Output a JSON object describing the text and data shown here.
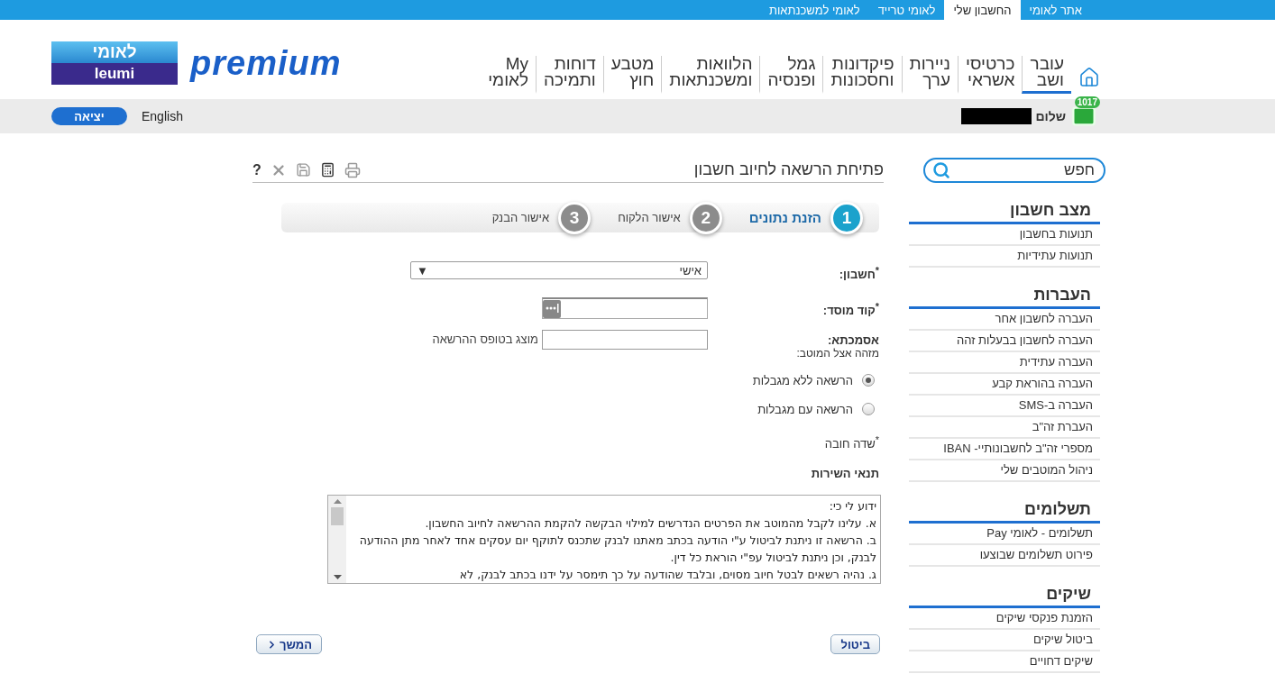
{
  "top_bar": {
    "tabs": [
      {
        "label": "אתר לאומי",
        "selected": false
      },
      {
        "label": "החשבון שלי",
        "selected": true
      },
      {
        "label": "לאומי טרייד",
        "selected": false
      },
      {
        "label": "לאומי למשכנתאות",
        "selected": false
      }
    ]
  },
  "logo": {
    "hebrew": "לאומי",
    "latin": "leumi",
    "tagline": "premium"
  },
  "main_nav": [
    {
      "label": "עובר ושב",
      "selected": true
    },
    {
      "label": "כרטיסי אשראי",
      "selected": false
    },
    {
      "label": "ניירות ערך",
      "selected": false
    },
    {
      "label": "פיקדונות וחסכונות",
      "selected": false
    },
    {
      "label": "גמל ופנסיה",
      "selected": false
    },
    {
      "label": "הלוואות ומשכנתאות",
      "selected": false
    },
    {
      "label": "מטבע חוץ",
      "selected": false
    },
    {
      "label": "דוחות ותמיכה",
      "selected": false
    },
    {
      "label": "My לאומי",
      "selected": false
    }
  ],
  "user_bar": {
    "messages_count": "1017",
    "greeting": "שלום",
    "language_link": "English",
    "logout_button": "יציאה"
  },
  "sidebar": {
    "search": {
      "placeholder": "חפש"
    },
    "sections": [
      {
        "title": "מצב חשבון",
        "items": [
          "תנועות בחשבון",
          "תנועות עתידיות"
        ]
      },
      {
        "title": "העברות",
        "items": [
          "העברה לחשבון אחר",
          "העברה לחשבון בבעלות זהה",
          "העברה עתידית",
          "העברה בהוראת קבע",
          "העברה ב-SMS",
          "העברת זה\"ב",
          "מספרי זה\"ב לחשבונותיי- IBAN",
          "ניהול המוטבים שלי"
        ]
      },
      {
        "title": "תשלומים",
        "items": [
          "תשלומים - לאומי Pay",
          "פירוט תשלומים שבוצעו"
        ]
      },
      {
        "title": "שיקים",
        "items": [
          "הזמנת פנקסי שיקים",
          "ביטול שיקים",
          "שיקים דחויים"
        ]
      }
    ]
  },
  "page": {
    "title": "פתיחת הרשאה לחיוב חשבון",
    "help_label": "?",
    "steps": [
      {
        "number": "1",
        "label": "הזנת נתונים",
        "selected": true
      },
      {
        "number": "2",
        "label": "אישור הלקוח",
        "selected": false
      },
      {
        "number": "3",
        "label": "אישור הבנק",
        "selected": false
      }
    ],
    "form": {
      "account": {
        "label": "$^{*}$חשבון:",
        "value": "אישי",
        "arrow": "▼"
      },
      "institution_code": {
        "label": "$^{*}$קוד מוסד:"
      },
      "reference": {
        "label": "אסמכתא:",
        "sublabel": "מזהה אצל המוטב:",
        "note": "מוצג בטופס ההרשאה"
      },
      "limit_options": [
        {
          "label": "הרשאה ללא מגבלות",
          "selected": true
        },
        {
          "label": "הרשאה עם מגבלות",
          "selected": false
        }
      ],
      "required_note": "$^{*}$שדה חובה"
    },
    "terms": {
      "title": "תנאי השירות",
      "paragraphs": [
        "ידוע לי כי:",
        "א. עלינו לקבל מהמוטב את הפרטים הנדרשים למילוי הבקשה להקמת ההרשאה לחיוב החשבון.",
        "ב. הרשאה זו ניתנת לביטול ע\"י הודעה בכתב מאתנו לבנק שתכנס לתוקף יום עסקים אחד לאחר מתן ההודעה לבנק, וכן ניתנת לביטול עפ\"י הוראת כל דין.",
        "ג. נהיה רשאים לבטל חיוב מסוים, ובלבד שהודעה על כך תימסר על ידנו בכתב לבנק, לא"
      ]
    },
    "buttons": {
      "cancel": "ביטול",
      "next": "המשך"
    }
  }
}
